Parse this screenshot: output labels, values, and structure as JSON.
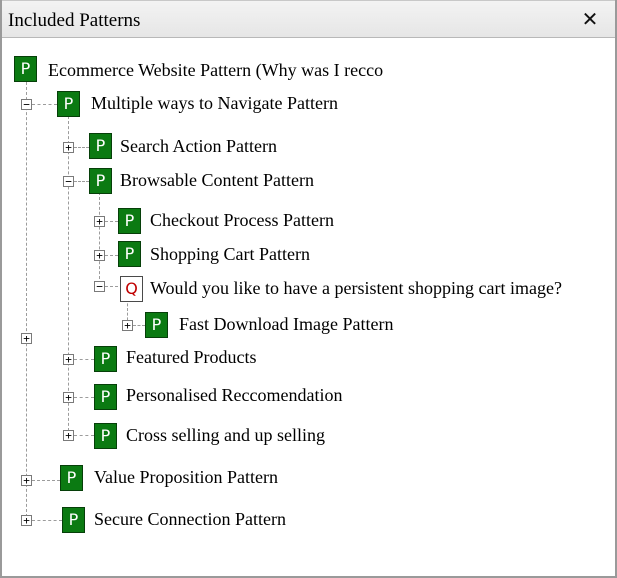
{
  "panel": {
    "title": "Included Patterns",
    "close_glyph": "✕"
  },
  "tree": {
    "root": {
      "icon": "P",
      "label": "Ecommerce Website Pattern (Why was I recco"
    },
    "multiple_ways": {
      "icon": "P",
      "label": "Multiple ways to Navigate Pattern",
      "expanded": true
    },
    "search_action": {
      "icon": "P",
      "label": "Search Action Pattern",
      "expanded": false
    },
    "browsable_content": {
      "icon": "P",
      "label": "Browsable Content Pattern",
      "expanded": true
    },
    "checkout_process": {
      "icon": "P",
      "label": "Checkout Process Pattern",
      "expanded": false
    },
    "shopping_cart": {
      "icon": "P",
      "label": "Shopping Cart Pattern",
      "expanded": false
    },
    "persistent_cart_question": {
      "icon": "Q",
      "label": "Would you like to have a persistent shopping cart image?",
      "expanded": true
    },
    "fast_download": {
      "icon": "P",
      "label": "Fast Download Image Pattern",
      "expanded": false
    },
    "featured_products": {
      "icon": "P",
      "label": "Featured Products",
      "expanded": false
    },
    "personalised": {
      "icon": "P",
      "label": "Personalised Reccomendation",
      "expanded": false
    },
    "cross_selling": {
      "icon": "P",
      "label": "Cross selling and up selling",
      "expanded": false
    },
    "value_proposition": {
      "icon": "P",
      "label": "Value Proposition Pattern",
      "expanded": false
    },
    "secure_connection": {
      "icon": "P",
      "label": "Secure Connection Pattern",
      "expanded": false
    }
  },
  "glyphs": {
    "plus": "+",
    "minus": "−"
  },
  "colors": {
    "pattern_icon_bg": "#0b7a12",
    "question_icon_fg": "#c00000",
    "tree_lines": "#9c9c9c"
  }
}
